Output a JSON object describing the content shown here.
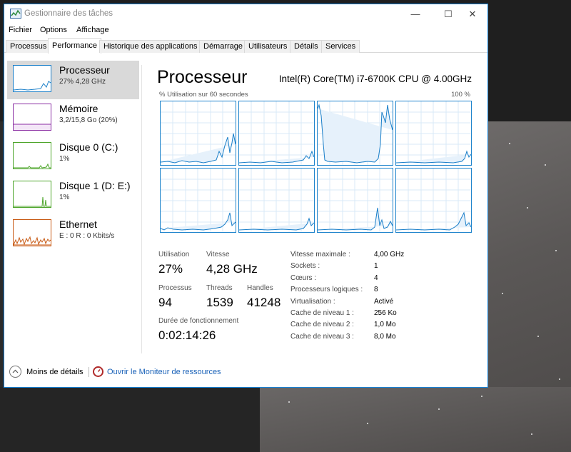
{
  "window": {
    "title": "Gestionnaire des tâches",
    "controls": {
      "minimize": "—",
      "maximize": "☐",
      "close": "✕"
    }
  },
  "menu": [
    "Fichier",
    "Options",
    "Affichage"
  ],
  "tabs": [
    "Processus",
    "Performance",
    "Historique des applications",
    "Démarrage",
    "Utilisateurs",
    "Détails",
    "Services"
  ],
  "active_tab": "Performance",
  "sidebar": [
    {
      "title": "Processeur",
      "sub": "27% 4,28 GHz",
      "color": "#1a7fc9",
      "active": true
    },
    {
      "title": "Mémoire",
      "sub": "3,2/15,8 Go (20%)",
      "color": "#8b2ea3",
      "active": false
    },
    {
      "title": "Disque 0 (C:)",
      "sub": "1%",
      "color": "#4da52a",
      "active": false
    },
    {
      "title": "Disque 1 (D: E:)",
      "sub": "1%",
      "color": "#4da52a",
      "active": false
    },
    {
      "title": "Ethernet",
      "sub": "E : 0 R : 0 Kbits/s",
      "color": "#c85a14",
      "active": false
    }
  ],
  "main": {
    "title": "Processeur",
    "cpu_name": "Intel(R) Core(TM) i7-6700K CPU @ 4.00GHz",
    "util_label": "% Utilisation sur 60 secondes",
    "util_max": "100 %",
    "graph_color": "#1a7fc9"
  },
  "stats": {
    "utilisation_label": "Utilisation",
    "utilisation": "27%",
    "vitesse_label": "Vitesse",
    "vitesse": "4,28 GHz",
    "processus_label": "Processus",
    "processus": "94",
    "threads_label": "Threads",
    "threads": "1539",
    "handles_label": "Handles",
    "handles": "41248",
    "uptime_label": "Durée de fonctionnement",
    "uptime": "0:02:14:26"
  },
  "details": [
    {
      "key": "Vitesse maximale :",
      "value": "4,00 GHz"
    },
    {
      "key": "Sockets :",
      "value": "1"
    },
    {
      "key": "Cœurs :",
      "value": "4"
    },
    {
      "key": "Processeurs logiques :",
      "value": "8"
    },
    {
      "key": "Virtualisation :",
      "value": "Activé"
    },
    {
      "key": "Cache de niveau 1 :",
      "value": "256 Ko"
    },
    {
      "key": "Cache de niveau 2 :",
      "value": "1,0 Mo"
    },
    {
      "key": "Cache de niveau 3 :",
      "value": "8,0 Mo"
    }
  ],
  "footer": {
    "less_details": "Moins de détails",
    "resource_monitor": "Ouvrir le Moniteur de ressources"
  }
}
